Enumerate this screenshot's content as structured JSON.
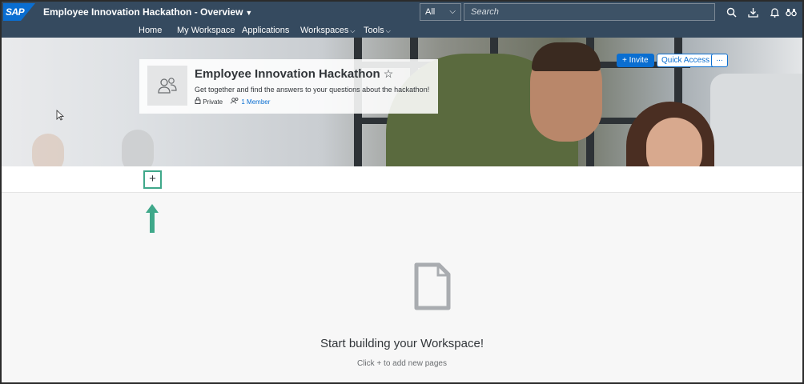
{
  "shell": {
    "logo": "SAP",
    "title": "Employee Innovation Hackathon - Overview",
    "search_scope": "All",
    "search_placeholder": "Search",
    "icons": [
      "search-icon",
      "download-icon",
      "bell-icon",
      "binoculars-icon"
    ]
  },
  "nav": {
    "items": [
      {
        "label": "Home"
      },
      {
        "label": "My Workspace"
      },
      {
        "label": "Applications"
      },
      {
        "label": "Workspaces"
      },
      {
        "label": "Tools"
      }
    ]
  },
  "banner": {
    "invite_label": "Invite",
    "quick_access_label": "Quick Access",
    "more_label": "..."
  },
  "workspace": {
    "title": "Employee Innovation Hackathon",
    "star": "☆",
    "description": "Get together and find the answers to your questions about the hackathon!",
    "privacy": "Private",
    "members": "1 Member"
  },
  "pagebar": {
    "add_label": "+"
  },
  "empty_state": {
    "title": "Start building your Workspace!",
    "subtitle": "Click + to add new pages"
  },
  "colors": {
    "shell": "#354a5f",
    "accent": "#0a6ed1",
    "highlight": "#3fa88a"
  }
}
